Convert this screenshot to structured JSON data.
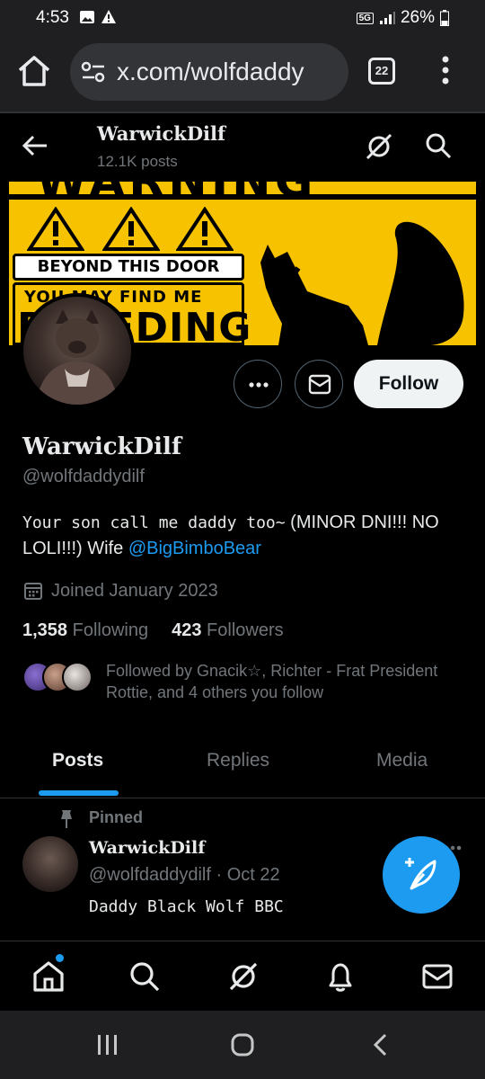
{
  "status_bar": {
    "time": "4:53",
    "network": "5G",
    "battery": "26%"
  },
  "browser": {
    "url": "x.com/wolfdaddy",
    "tab_count": "22"
  },
  "header": {
    "title": "WarwickDilf",
    "posts_count": "12.1K posts"
  },
  "banner": {
    "warning_top": "WARNING",
    "door_text": "BEYOND THIS DOOR",
    "find_text": "YOU MAY FIND ME",
    "big_text": "BREEDING"
  },
  "profile": {
    "display_name": "WarwickDilf",
    "handle": "@wolfdaddydilf",
    "bio_mono": "Your son call me daddy too~",
    "bio_rest": " (MINOR DNI!!! NO LOLI!!!) Wife ",
    "bio_mention": "@BigBimboBear",
    "joined": "Joined January 2023",
    "following_count": "1,358",
    "following_label": "Following",
    "followers_count": "423",
    "followers_label": "Followers",
    "followed_by": "Followed by Gnacik☆, Richter - Frat President Rottie, and 4 others you follow",
    "follow_button": "Follow"
  },
  "tabs": [
    "Posts",
    "Replies",
    "Media"
  ],
  "pinned_post": {
    "label": "Pinned",
    "name": "WarwickDilf",
    "meta": "@wolfdaddydilf · Oct 22",
    "text": "Daddy Black Wolf BBC"
  },
  "colors": {
    "accent": "#1d9bf0",
    "background": "#000000",
    "banner_yellow": "#f7c300",
    "muted_text": "#71767b"
  },
  "icons": {
    "bottom_nav": [
      "home-icon",
      "search-icon",
      "grok-icon",
      "notifications-icon",
      "messages-icon"
    ]
  }
}
